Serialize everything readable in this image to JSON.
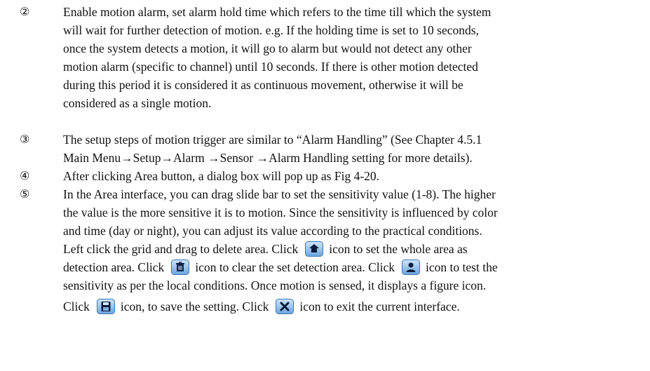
{
  "items": [
    {
      "number": "②",
      "lines": [
        "Enable motion alarm, set alarm hold time which refers to the time till which the system",
        "will wait for further detection of motion. e.g. If the holding time is set to 10 seconds,",
        "once the system detects a motion, it will go to alarm but would not detect any other",
        "motion alarm (specific to channel) until 10 seconds. If there is other motion detected",
        "during this period it is considered it as continuous movement, otherwise it will be",
        "considered as a single motion."
      ]
    },
    {
      "number": "③",
      "lines": [
        "The setup steps of motion trigger are similar to “Alarm Handling” (See Chapter 4.5.1",
        "Main Menu→Setup→Alarm →Sensor →Alarm Handling setting for more details)."
      ]
    },
    {
      "number": "④",
      "lines": [
        "After clicking Area button, a dialog box will pop up as Fig 4-20."
      ]
    },
    {
      "number": "⑤",
      "lines": [
        "In the Area interface, you can drag slide bar to set the sensitivity value (1-8). The higher",
        "the value is the more sensitive it is to motion. Since the sensitivity is influenced by color",
        "and time (day or night), you can adjust its value according to the practical conditions."
      ],
      "icon_lines": {
        "l4a": "Left click the grid and drag to delete area. Click",
        "l4b": "icon to set the whole area as",
        "l5a": "detection area. Click",
        "l5b": "icon to clear the set detection area. Click",
        "l5c": "icon to test the",
        "l6": "sensitivity as per the local conditions. Once motion is sensed, it displays a figure icon.",
        "l7a": "Click",
        "l7b": "icon, to save the setting. Click",
        "l7c": "icon to exit the current interface."
      }
    }
  ],
  "icons": {
    "area": "select-all-area-icon",
    "clear": "clear-trash-icon",
    "test": "test-person-icon",
    "save": "save-floppy-icon",
    "exit": "exit-close-icon"
  }
}
